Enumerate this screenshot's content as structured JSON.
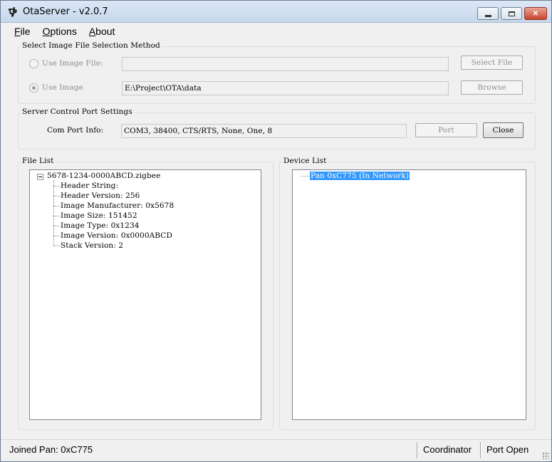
{
  "window": {
    "title": "OtaServer - v2.0.7"
  },
  "menu": [
    {
      "label": "File"
    },
    {
      "label": "Options"
    },
    {
      "label": "About"
    }
  ],
  "image_group": {
    "title": "Select Image File Selection Method",
    "use_image_file_label": "Use Image File:",
    "use_image_file_value": "",
    "use_image_label": "Use Image",
    "use_image_value": "E:\\Project\\OTA\\data",
    "select_file_button": "Select File",
    "browse_button": "Browse"
  },
  "port_group": {
    "title": "Server Control Port Settings",
    "com_port_label": "Com Port Info:",
    "com_port_value": "COM3, 38400, CTS/RTS, None, One, 8",
    "port_button": "Port",
    "close_button": "Close"
  },
  "file_list": {
    "title": "File List",
    "root": "5678-1234-0000ABCD.zigbee",
    "children": [
      "Header String:",
      "Header Version: 256",
      "Image Manufacturer: 0x5678",
      "Image Size: 151452",
      "Image Type: 0x1234",
      "Image Version: 0x0000ABCD",
      "Stack Version: 2"
    ]
  },
  "device_list": {
    "title": "Device List",
    "items": [
      "Pan 0xC775 (In Network)"
    ]
  },
  "status": {
    "joined": "Joined Pan: 0xC775",
    "role": "Coordinator",
    "port_state": "Port Open"
  }
}
